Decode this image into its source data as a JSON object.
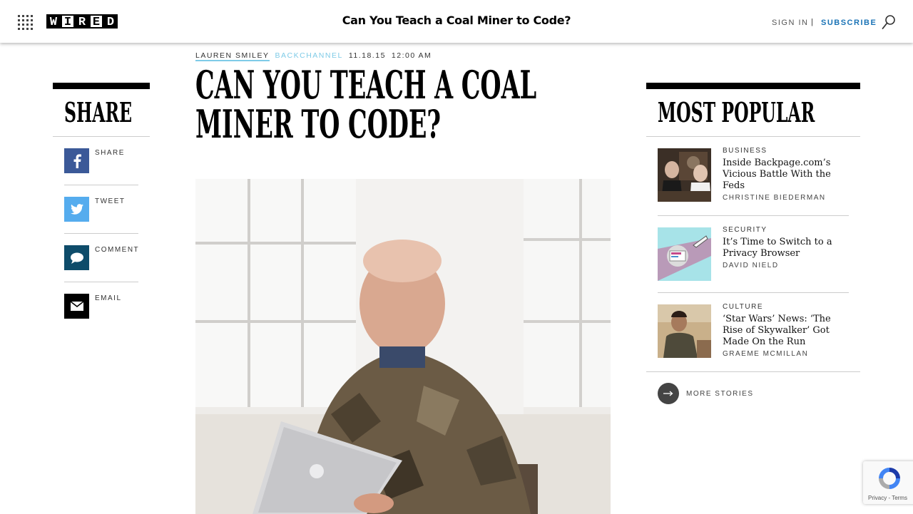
{
  "header": {
    "logo_letters": [
      "W",
      "I",
      "R",
      "E",
      "D"
    ],
    "title": "Can You Teach a Coal Miner to Code?",
    "sign_in": "SIGN IN",
    "separator": "|",
    "subscribe": "SUBSCRIBE"
  },
  "article": {
    "author": "LAUREN SMILEY",
    "category": "BACKCHANNEL",
    "date": "11.18.15",
    "time": "12:00 AM",
    "headline": "CAN YOU TEACH A COAL MINER TO CODE?"
  },
  "share": {
    "heading": "SHARE",
    "items": [
      {
        "label": "SHARE",
        "icon": "facebook-icon",
        "color": "#3b5998"
      },
      {
        "label": "TWEET",
        "icon": "twitter-icon",
        "color": "#55acee"
      },
      {
        "label": "COMMENT",
        "icon": "comment-icon",
        "color": "#0e4c6a"
      },
      {
        "label": "EMAIL",
        "icon": "email-icon",
        "color": "#000000"
      }
    ]
  },
  "most_popular": {
    "heading": "MOST POPULAR",
    "items": [
      {
        "category": "BUSINESS",
        "title": "Inside Backpage.com’s Vicious Battle With the Feds",
        "author": "CHRISTINE BIEDERMAN"
      },
      {
        "category": "SECURITY",
        "title": "It’s Time to Switch to a Privacy Browser",
        "author": "DAVID NIELD"
      },
      {
        "category": "CULTURE",
        "title": "‘Star Wars’ News: ‘The Rise of Skywalker’ Got Made On the Run",
        "author": "GRAEME MCMILLAN"
      }
    ],
    "more_label": "MORE STORIES"
  },
  "recaptcha": {
    "text": "Privacy - Terms"
  },
  "colors": {
    "accent": "#1a73b6",
    "category_blue": "#7fcbe7"
  }
}
